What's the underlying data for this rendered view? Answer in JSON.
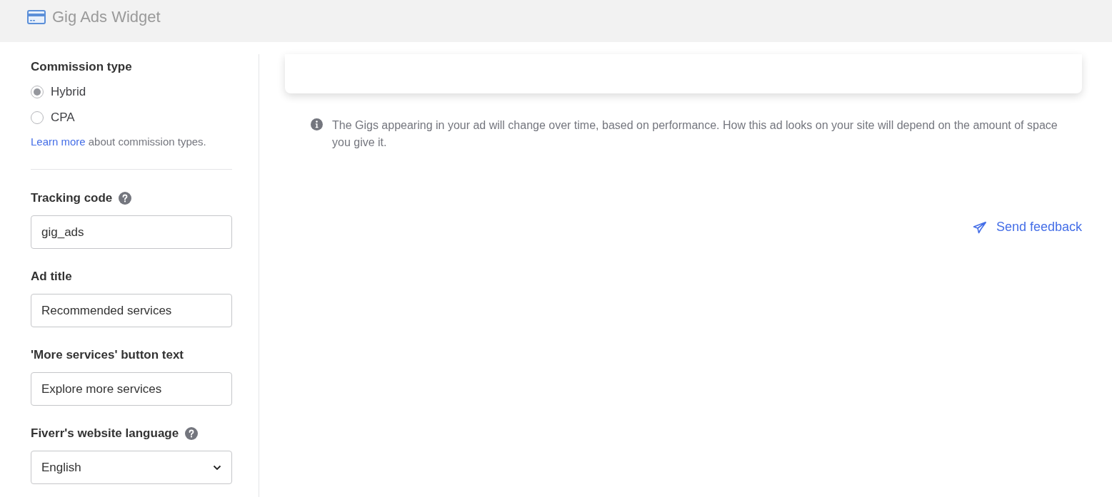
{
  "header": {
    "title": "Gig Ads Widget"
  },
  "sidebar": {
    "commission": {
      "label": "Commission type",
      "options": [
        {
          "label": "Hybrid",
          "selected": true
        },
        {
          "label": "CPA",
          "selected": false
        }
      ],
      "learn_more_link": "Learn more",
      "learn_more_text": "about commission types."
    },
    "fields": [
      {
        "kind": "text",
        "label": "Tracking code",
        "help": true,
        "value": "gig_ads"
      },
      {
        "kind": "text",
        "label": "Ad title",
        "help": false,
        "value": "Recommended services"
      },
      {
        "kind": "text",
        "label": "'More services' button text",
        "help": false,
        "value": "Explore more services"
      },
      {
        "kind": "select",
        "label": "Fiverr's website language",
        "help": true,
        "value": "English"
      }
    ]
  },
  "main": {
    "info": "The Gigs appearing in your ad will change over time, based on performance. How this ad looks on your site will depend on the amount of space you give it.",
    "feedback": "Send feedback"
  }
}
